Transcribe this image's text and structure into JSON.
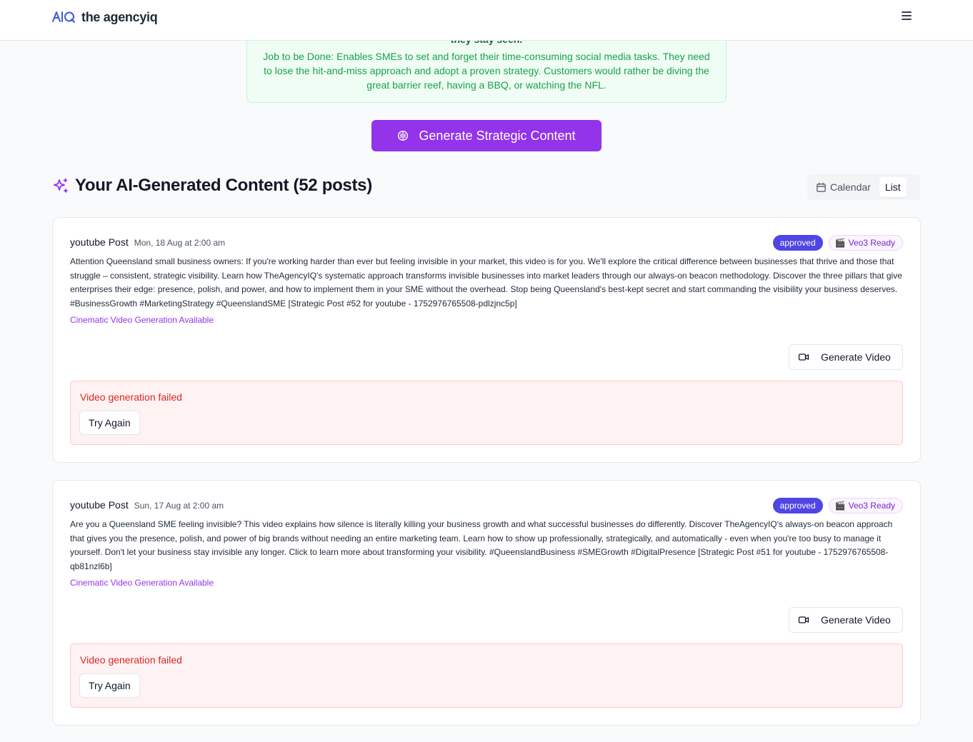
{
  "header": {
    "logo_text": "the agencyiq",
    "logo_mark_text": "AIQ"
  },
  "jtbd": {
    "partial_heading": "they stay seen.",
    "text": "Job to be Done: Enables SMEs to set and forget their time-consuming social media tasks. They need to lose the hit-and-miss approach and adopt a proven strategy. Customers would rather be diving the great barrier reef, having a BBQ, or watching the NFL."
  },
  "generate_button": {
    "label": "Generate Strategic Content"
  },
  "section": {
    "title": "Your AI-Generated Content (52 posts)"
  },
  "view_toggle": {
    "calendar_label": "Calendar",
    "list_label": "List",
    "active": "List"
  },
  "colors": {
    "accent": "#9333ea",
    "approved": "#4f46e5",
    "fail": "#dc2626",
    "success": "#16a34a"
  },
  "posts": [
    {
      "type": "youtube Post",
      "date": "Mon, 18 Aug at 2:00 am",
      "status": "approved",
      "veo_badge": "Veo3 Ready",
      "veo_emoji": "🎬",
      "body": "Attention Queensland small business owners: If you're working harder than ever but feeling invisible in your market, this video is for you. We'll explore the critical difference between businesses that thrive and those that struggle – consistent, strategic visibility. Learn how TheAgencyIQ's systematic approach transforms invisible businesses into market leaders through our always-on beacon methodology. Discover the three pillars that give enterprises their edge: presence, polish, and power, and how to implement them in your SME without the overhead. Stop being Queensland's best-kept secret and start commanding the visibility your business deserves. #BusinessGrowth #MarketingStrategy #QueenslandSME [Strategic Post #52 for youtube - 1752976765508-pdlzjnc5p]",
      "cinematic_label": "Cinematic Video Generation Available",
      "video_button": "Generate Video",
      "fail_text": "Video generation failed",
      "retry_label": "Try Again"
    },
    {
      "type": "youtube Post",
      "date": "Sun, 17 Aug at 2:00 am",
      "status": "approved",
      "veo_badge": "Veo3 Ready",
      "veo_emoji": "🎬",
      "body": "Are you a Queensland SME feeling invisible? This video explains how silence is literally killing your business growth and what successful businesses do differently. Discover TheAgencyIQ's always-on beacon approach that gives you the presence, polish, and power of big brands without needing an entire marketing team. Learn how to show up professionally, strategically, and automatically - even when you're too busy to manage it yourself. Don't let your business stay invisible any longer. Click to learn more about transforming your visibility. #QueenslandBusiness #SMEGrowth #DigitalPresence [Strategic Post #51 for youtube - 1752976765508-qb81nzl6b]",
      "cinematic_label": "Cinematic Video Generation Available",
      "video_button": "Generate Video",
      "fail_text": "Video generation failed",
      "retry_label": "Try Again"
    }
  ]
}
